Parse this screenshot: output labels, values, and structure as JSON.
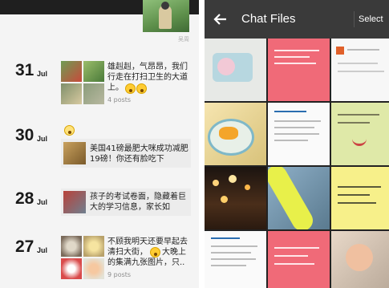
{
  "moments": {
    "cover_label": "吴周",
    "entries": [
      {
        "day": "31",
        "month": "Jul",
        "text": "雄赳赳，气昂昂，我们行走在打扫卫生的大道上。",
        "posts": "4 posts"
      },
      {
        "day": "30",
        "month": "Jul",
        "text": "美国41磅最肥大咪成功减肥19磅！你还有脸吃下",
        "posts": ""
      },
      {
        "day": "28",
        "month": "Jul",
        "text": "孩子的考试卷面，隐藏着巨大的学习信息，家长如",
        "posts": ""
      },
      {
        "day": "27",
        "month": "Jul",
        "text_line1": "不顾我明天还要早起去",
        "text_line2": "清扫大街，",
        "text_line2b": "大晚上",
        "text_line3": "的集满九张图片，只..",
        "posts": "9 posts"
      }
    ]
  },
  "chat_files": {
    "title": "Chat Files",
    "select_label": "Select",
    "back_icon": "arrow-left-icon",
    "colors": {
      "appbar": "#3a3a3a",
      "pink": "#f06a78",
      "light_green": "#dfe9a8",
      "yellow": "#f7f08a"
    }
  }
}
